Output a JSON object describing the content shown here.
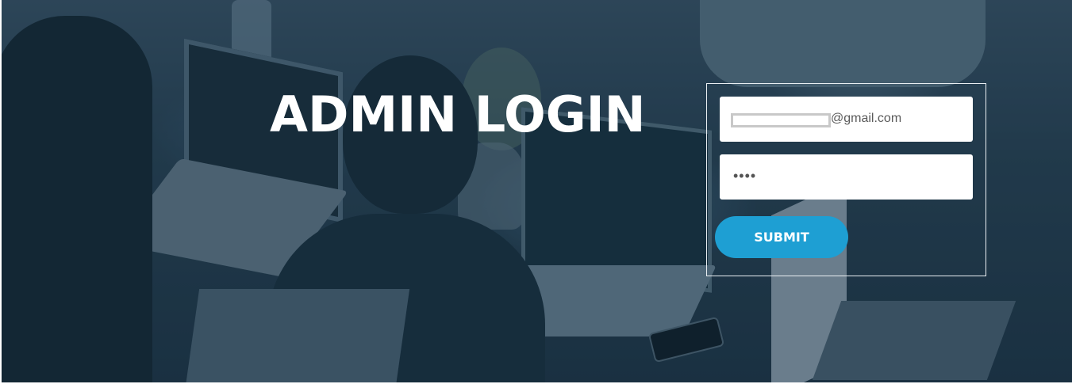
{
  "page": {
    "title": "ADMIN LOGIN"
  },
  "login_form": {
    "email_field": {
      "value_suffix": "@gmail.com"
    },
    "password_field": {
      "value_masked": "••••"
    },
    "submit_label": "SUBMIT"
  },
  "colors": {
    "accent": "#1e9fd3",
    "title_text": "#ffffff",
    "form_border": "#e9eef2"
  }
}
